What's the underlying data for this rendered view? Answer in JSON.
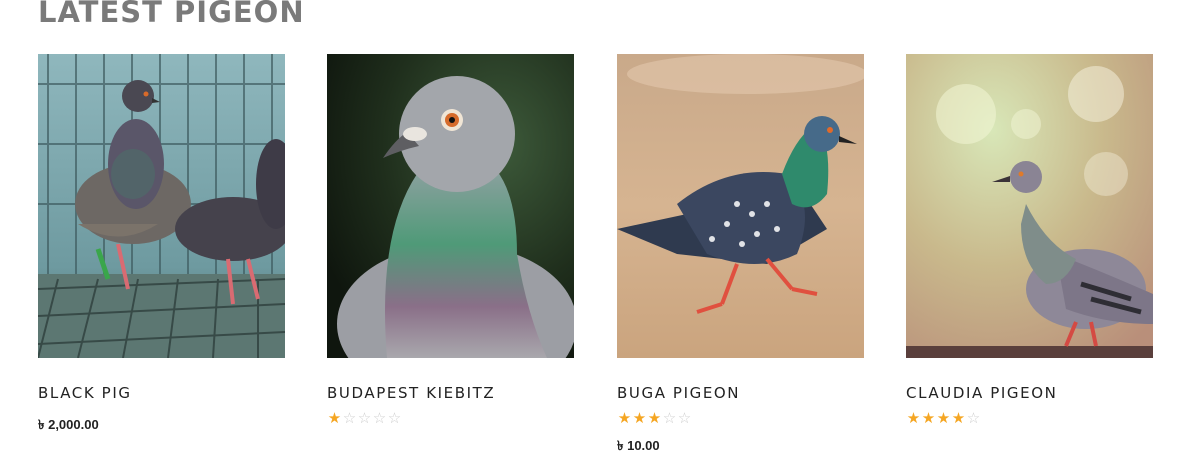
{
  "section": {
    "title": "LATEST PIGEON"
  },
  "colors": {
    "star_filled": "#f5a623",
    "star_empty": "#cfcfcf",
    "title": "#7a7a7a"
  },
  "products": [
    {
      "name": "BLACK PIG",
      "price": "৳ 2,000.00",
      "rating": null,
      "image": "photo of dark pigeons in a cage"
    },
    {
      "name": "BUDAPEST KIEBITZ",
      "price": null,
      "rating": 1,
      "image": "close-up photo of grey pigeon"
    },
    {
      "name": "BUGA PIGEON",
      "price": "৳ 10.00",
      "rating": 3,
      "image": "photo of checkered pigeon walking on sand"
    },
    {
      "name": "CLAUDIA PIGEON",
      "price": null,
      "rating": 4,
      "image": "photo of grey pigeon perched on branch"
    }
  ]
}
